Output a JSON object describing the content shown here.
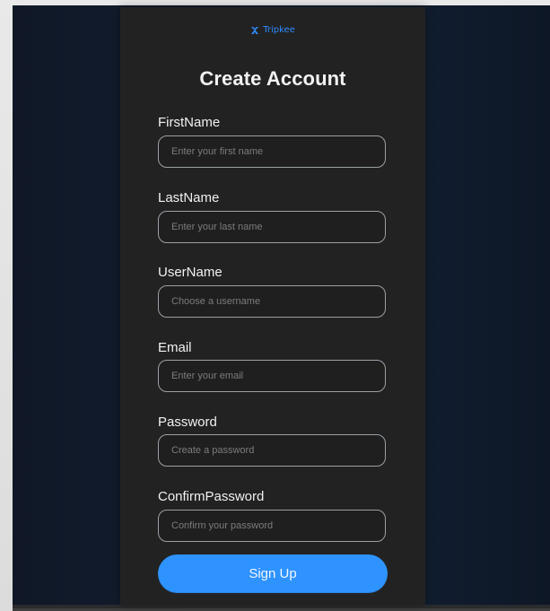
{
  "app": {
    "logo_text": "Tripkee",
    "logo_icon": "tripkee-logo-icon",
    "title": "Create Account"
  },
  "form": {
    "fields": [
      {
        "label": "FirstName",
        "placeholder": "Enter your first name"
      },
      {
        "label": "LastName",
        "placeholder": "Enter your last name"
      },
      {
        "label": "UserName",
        "placeholder": "Choose a username"
      },
      {
        "label": "Email",
        "placeholder": "Enter your email"
      },
      {
        "label": "Password",
        "placeholder": "Create a password"
      },
      {
        "label": "ConfirmPassword",
        "placeholder": "Confirm your password"
      }
    ],
    "submit_label": "Sign Up"
  },
  "colors": {
    "page_background": "#111b2b",
    "card_background": "#222222",
    "primary_button": "#2e93ff",
    "logo_accent": "#2e8cff"
  }
}
